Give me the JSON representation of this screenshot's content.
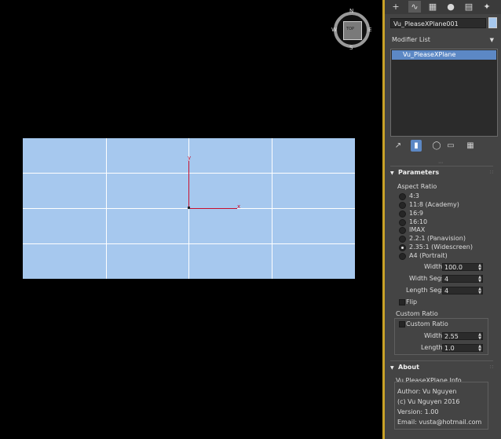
{
  "viewport": {
    "compass": {
      "n": "N",
      "s": "S",
      "e": "E",
      "w": "W"
    },
    "cube_label": "TOP",
    "axis": {
      "x": "x",
      "y": "y"
    },
    "plane_color": "#a6c8ee",
    "axis_color": "#c8102e"
  },
  "command_panel": {
    "tabs": [
      "plus-icon",
      "curve-icon",
      "hierarchy-icon",
      "motion-icon",
      "display-icon",
      "wrench-icon"
    ],
    "object_name": "Vu_PleaseXPlane001",
    "object_color": "#a6c8ee",
    "modifier_list_label": "Modifier List",
    "stack_items": [
      "Vu_PleaseXPlane"
    ],
    "stack_tools": [
      "pin-icon",
      "show-end-result-icon",
      "make-unique-icon",
      "remove-modifier-icon",
      "configure-modifier-sets-icon"
    ]
  },
  "parameters": {
    "title": "Parameters",
    "aspect_ratio_label": "Aspect Ratio",
    "aspect_options": [
      "4:3",
      "11:8 (Academy)",
      "16:9",
      "16:10",
      "IMAX",
      "2.2:1 (Panavision)",
      "2.35:1 (Widescreen)",
      "A4 (Portrait)"
    ],
    "selected_aspect": "2.35:1 (Widescreen)",
    "width_label": "Width",
    "width_value": "100.0",
    "width_segs_label": "Width Segs",
    "width_segs_value": "4",
    "length_segs_label": "Length Segs",
    "length_segs_value": "4",
    "flip_label": "Flip",
    "flip_checked": false,
    "custom_ratio_group": "Custom Ratio",
    "custom_ratio_label": "Custom Ratio",
    "custom_ratio_checked": false,
    "custom_width_label": "Width",
    "custom_width_value": "2.55",
    "custom_length_label": "Length",
    "custom_length_value": "1.0"
  },
  "about": {
    "title": "About",
    "info_title": "Vu PleaseXPlane Info",
    "author": "Author: Vu Nguyen",
    "copyright": "(c) Vu Nguyen 2016",
    "version": "Version: 1.00",
    "email": "Email: vusta@hotmail.com"
  }
}
